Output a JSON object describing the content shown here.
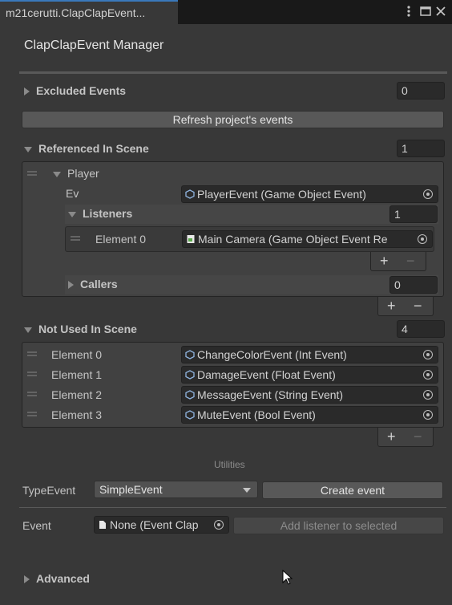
{
  "window": {
    "tab_title": "m21cerutti.ClapClapEvent...",
    "menu_icon": "kebab-menu-icon",
    "maximize_icon": "maximize-icon",
    "close_icon": "close-icon"
  },
  "header": {
    "title": "ClapClapEvent Manager"
  },
  "excluded": {
    "label": "Excluded Events",
    "count": "0"
  },
  "refresh_label": "Refresh project's events",
  "referenced": {
    "label": "Referenced In Scene",
    "count": "1",
    "player": {
      "label": "Player",
      "ev_label": "Ev",
      "ev_value": "PlayerEvent (Game Object Event)",
      "listeners": {
        "label": "Listeners",
        "count": "1",
        "items": [
          {
            "label": "Element 0",
            "value": "Main Camera (Game Object Event Re"
          }
        ]
      },
      "callers": {
        "label": "Callers",
        "count": "0"
      }
    }
  },
  "not_used": {
    "label": "Not Used In Scene",
    "count": "4",
    "items": [
      {
        "label": "Element 0",
        "value": "ChangeColorEvent (Int Event)"
      },
      {
        "label": "Element 1",
        "value": "DamageEvent (Float Event)"
      },
      {
        "label": "Element 2",
        "value": "MessageEvent (String Event)"
      },
      {
        "label": "Element 3",
        "value": "MuteEvent (Bool Event)"
      }
    ]
  },
  "utilities": {
    "label": "Utilities",
    "type_event_label": "TypeEvent",
    "type_event_value": "SimpleEvent",
    "create_event_label": "Create event",
    "event_label": "Event",
    "event_value": "None (Event Clap",
    "add_listener_label": "Add listener to selected"
  },
  "advanced": {
    "label": "Advanced"
  },
  "plus": "+",
  "minus": "−",
  "colors": {
    "accent": "#3a79bb",
    "background": "#383838",
    "field": "#2a2a2a"
  }
}
